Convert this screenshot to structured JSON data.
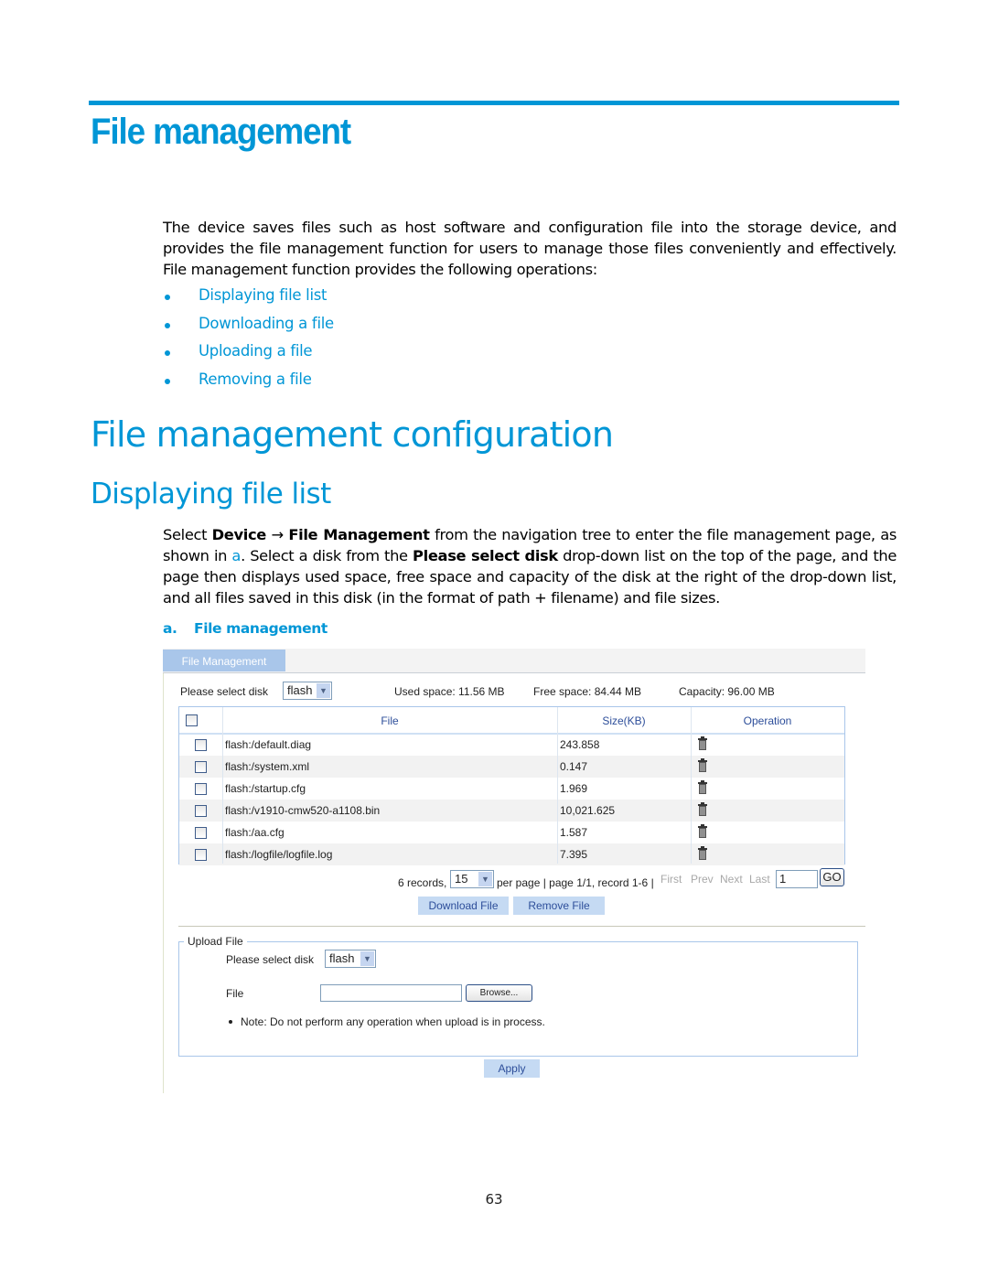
{
  "document": {
    "title": "File management",
    "intro": "The device saves files such as host software and configuration file into the storage device, and provides the file management function for users to manage those files conveniently and effectively. File management function provides the following operations:",
    "operations": [
      "Displaying file list",
      "Downloading a file",
      "Uploading a file",
      "Removing a file"
    ],
    "heading1": "File management configuration",
    "heading2": "Displaying file list",
    "desc": {
      "t1": "Select ",
      "b1": "Device",
      "arrow": " → ",
      "b2": "File Management",
      "t2": " from the navigation tree to enter the file management page, as shown in ",
      "ref": "a",
      "t3": ". Select a disk from the ",
      "b3": "Please select disk",
      "t4": " drop-down list on the top of the page, and the page then displays used space, free space and capacity of the disk at the right of the drop-down list, and all files saved in this disk (in the format of path + filename) and file sizes."
    },
    "figure_caption": {
      "num": "a.",
      "text": "File management"
    },
    "page_number": "63"
  },
  "ui": {
    "tab_label": "File Management",
    "disk_label": "Please select disk",
    "disk_value": "flash",
    "used_space": "Used space: 11.56 MB",
    "free_space": "Free space: 84.44 MB",
    "capacity": "Capacity: 96.00 MB",
    "columns": {
      "file": "File",
      "size": "Size(KB)",
      "operation": "Operation"
    },
    "files": [
      {
        "name": "flash:/default.diag",
        "size": "243.858"
      },
      {
        "name": "flash:/system.xml",
        "size": "0.147"
      },
      {
        "name": "flash:/startup.cfg",
        "size": "1.969"
      },
      {
        "name": "flash:/v1910-cmw520-a1108.bin",
        "size": "10,021.625"
      },
      {
        "name": "flash:/aa.cfg",
        "size": "1.587"
      },
      {
        "name": "flash:/logfile/logfile.log",
        "size": "7.395"
      }
    ],
    "pager": {
      "records": "6 records,",
      "per_page_value": "15",
      "info": "per page | page 1/1, record 1-6 |",
      "first": "First",
      "prev": "Prev",
      "next": "Next",
      "last": "Last",
      "page_input": "1",
      "go": "GO"
    },
    "download_button": "Download File",
    "remove_button": "Remove File",
    "upload": {
      "legend": "Upload File",
      "disk_label": "Please select disk",
      "disk_value": "flash",
      "file_label": "File",
      "file_value": "",
      "browse": "Browse...",
      "note": "Note: Do not perform any operation when upload is in process.",
      "apply": "Apply"
    }
  },
  "colors": {
    "accent": "#0096d6",
    "tab": "#a9c6ea",
    "button": "#c5daf3",
    "header_text": "#2d4e9a"
  }
}
